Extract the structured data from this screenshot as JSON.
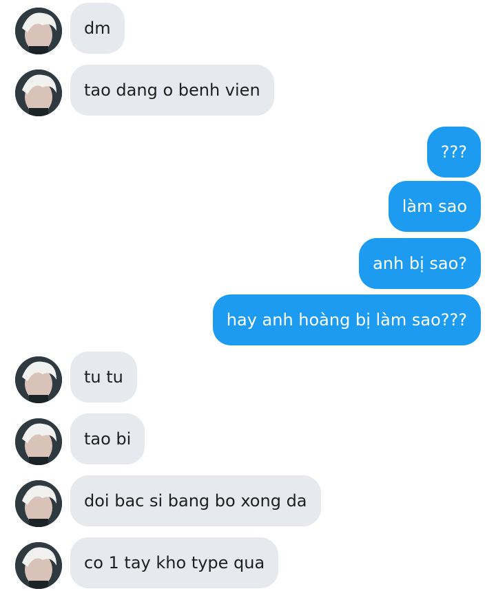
{
  "messages": [
    {
      "side": "in",
      "text": "dm"
    },
    {
      "side": "in",
      "text": "tao dang o benh vien"
    },
    {
      "side": "out",
      "text": "???"
    },
    {
      "side": "out",
      "text": "làm sao"
    },
    {
      "side": "out",
      "text": "anh bị sao?"
    },
    {
      "side": "out",
      "text": "hay anh hoàng bị làm sao???"
    },
    {
      "side": "in",
      "text": "tu tu"
    },
    {
      "side": "in",
      "text": "tao bi"
    },
    {
      "side": "in",
      "text": "doi bac si bang bo xong da"
    },
    {
      "side": "in",
      "text": "co 1 tay kho type qua"
    }
  ],
  "colors": {
    "incoming_bubble": "#e6e9ed",
    "outgoing_bubble": "#1d9bf0"
  }
}
